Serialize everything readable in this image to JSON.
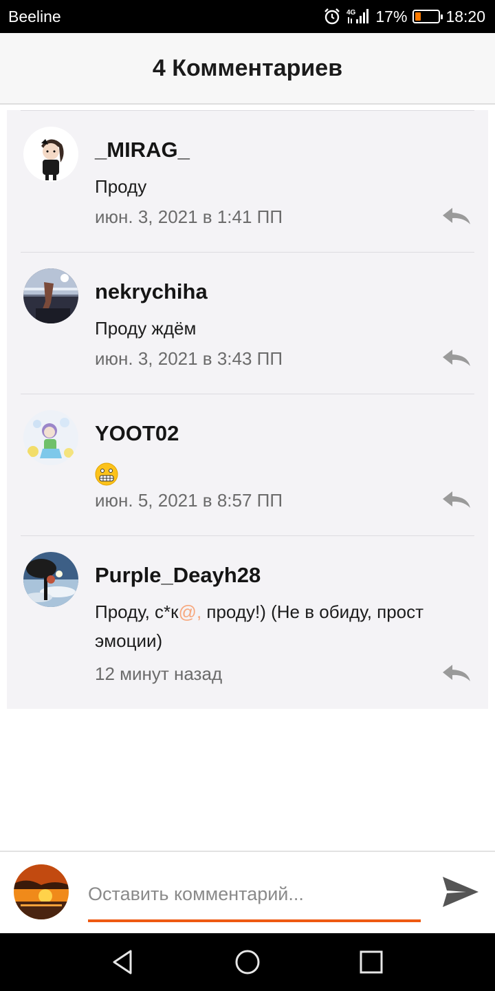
{
  "status_bar": {
    "carrier": "Beeline",
    "network": "4G",
    "battery": "17%",
    "battery_level": 0.17,
    "time": "18:20",
    "icons": [
      "alarm-icon",
      "signal-icon",
      "battery-icon"
    ]
  },
  "header": {
    "title": "4 Комментариев"
  },
  "comments": [
    {
      "name": "_MIRAG_",
      "text": "Проду",
      "time": "июн. 3, 2021 в 1:41 ПП",
      "avatar": "avatar-chibi-girl"
    },
    {
      "name": "nekrychiha",
      "text": "Проду ждём",
      "time": "июн. 3, 2021 в 3:43 ПП",
      "avatar": "avatar-photo-dark"
    },
    {
      "name": "YOOT02",
      "text": "",
      "emoji": "grimacing-face-emoji",
      "time": "июн. 5, 2021 в 8:57 ПП",
      "avatar": "avatar-chibi-purple"
    },
    {
      "name": "Purple_Deayh28",
      "text_before": "Проду, с*к",
      "text_at": "@,",
      "text_after": " проду!) (Не в обиду, прост эмоции)",
      "time": "12 минут назад",
      "avatar": "avatar-tree-sky"
    }
  ],
  "input": {
    "placeholder": "Оставить комментарий...",
    "value": "",
    "accent_color": "#ee5a12"
  },
  "nav": {
    "icons": [
      "back-icon",
      "home-icon",
      "recents-icon"
    ]
  }
}
